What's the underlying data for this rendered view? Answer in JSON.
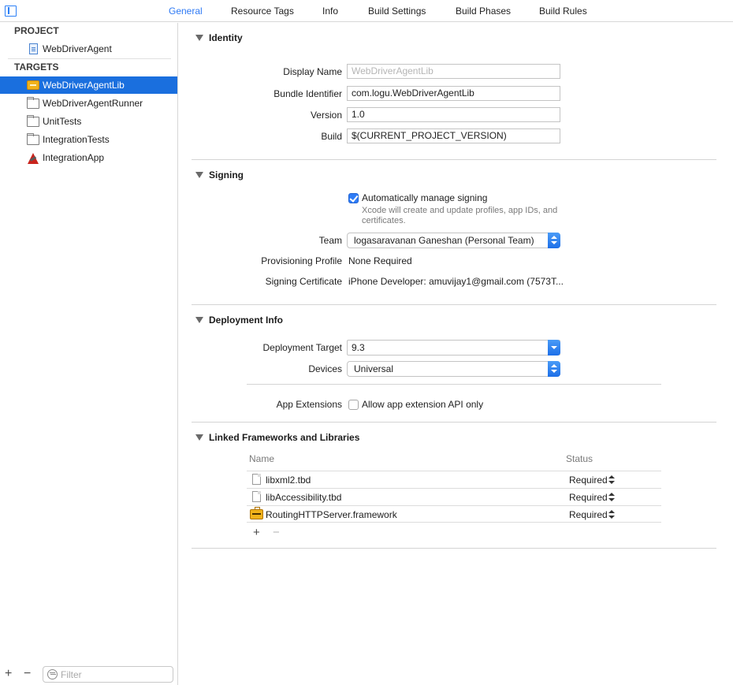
{
  "tabs": [
    "General",
    "Resource Tags",
    "Info",
    "Build Settings",
    "Build Phases",
    "Build Rules"
  ],
  "active_tab": "General",
  "sidebar": {
    "project_heading": "PROJECT",
    "project_items": [
      {
        "label": "WebDriverAgent",
        "icon": "project-file-icon"
      }
    ],
    "targets_heading": "TARGETS",
    "target_items": [
      {
        "label": "WebDriverAgentLib",
        "icon": "library-icon",
        "selected": true
      },
      {
        "label": "WebDriverAgentRunner",
        "icon": "folder-icon"
      },
      {
        "label": "UnitTests",
        "icon": "folder-icon"
      },
      {
        "label": "IntegrationTests",
        "icon": "folder-icon"
      },
      {
        "label": "IntegrationApp",
        "icon": "app-icon"
      }
    ],
    "filter_placeholder": "Filter",
    "add_label": "+",
    "remove_label": "−"
  },
  "identity": {
    "title": "Identity",
    "display_name_label": "Display Name",
    "display_name_placeholder": "WebDriverAgentLib",
    "bundle_id_label": "Bundle Identifier",
    "bundle_id_value": "com.logu.WebDriverAgentLib",
    "version_label": "Version",
    "version_value": "1.0",
    "build_label": "Build",
    "build_value": "$(CURRENT_PROJECT_VERSION)"
  },
  "signing": {
    "title": "Signing",
    "auto_label": "Automatically manage signing",
    "auto_checked": true,
    "auto_note": "Xcode will create and update profiles, app IDs, and certificates.",
    "team_label": "Team",
    "team_value": "logasaravanan Ganeshan (Personal Team)",
    "profile_label": "Provisioning Profile",
    "profile_value": "None Required",
    "cert_label": "Signing Certificate",
    "cert_value": "iPhone Developer: amuvijay1@gmail.com (7573T..."
  },
  "deployment": {
    "title": "Deployment Info",
    "target_label": "Deployment Target",
    "target_value": "9.3",
    "devices_label": "Devices",
    "devices_value": "Universal",
    "extensions_label": "App Extensions",
    "extensions_option": "Allow app extension API only",
    "extensions_checked": false
  },
  "frameworks": {
    "title": "Linked Frameworks and Libraries",
    "col_name": "Name",
    "col_status": "Status",
    "rows": [
      {
        "name": "libxml2.tbd",
        "status": "Required",
        "icon": "file-icon"
      },
      {
        "name": "libAccessibility.tbd",
        "status": "Required",
        "icon": "file-icon"
      },
      {
        "name": "RoutingHTTPServer.framework",
        "status": "Required",
        "icon": "framework-icon"
      }
    ],
    "add_label": "+",
    "remove_label": "−"
  },
  "colors": {
    "accent": "#2f7af4",
    "selection": "#1a6fde"
  }
}
